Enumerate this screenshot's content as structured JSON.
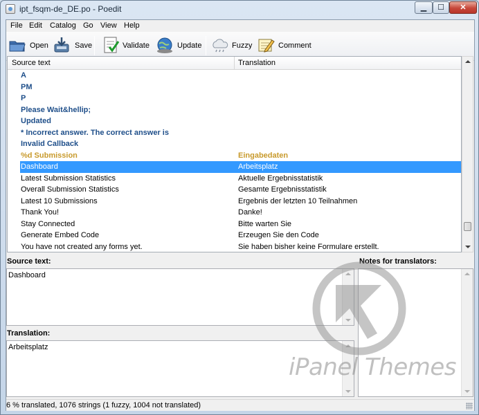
{
  "window": {
    "title": "ipt_fsqm-de_DE.po - Poedit",
    "min_glyph": "▁",
    "max_glyph": "☐",
    "close_glyph": "✕"
  },
  "menu": [
    "File",
    "Edit",
    "Catalog",
    "Go",
    "View",
    "Help"
  ],
  "toolbar": {
    "open": "Open",
    "save": "Save",
    "validate": "Validate",
    "update": "Update",
    "fuzzy": "Fuzzy",
    "comment": "Comment"
  },
  "list": {
    "col_source": "Source text",
    "col_translation": "Translation",
    "rows": [
      {
        "source": "A",
        "translation": "",
        "state": "untranslated"
      },
      {
        "source": "PM",
        "translation": "",
        "state": "untranslated"
      },
      {
        "source": "P",
        "translation": "",
        "state": "untranslated"
      },
      {
        "source": "Please Wait&hellip;",
        "translation": "",
        "state": "untranslated"
      },
      {
        "source": "Updated",
        "translation": "",
        "state": "untranslated"
      },
      {
        "source": "* Incorrect answer. The correct answer is",
        "translation": "",
        "state": "untranslated"
      },
      {
        "source": "Invalid Callback",
        "translation": "",
        "state": "untranslated"
      },
      {
        "source": "%d Submission",
        "translation": "Eingabedaten",
        "state": "fuzzy"
      },
      {
        "source": "Dashboard",
        "translation": "Arbeitsplatz",
        "state": "selected"
      },
      {
        "source": "Latest Submission Statistics",
        "translation": "Aktuelle Ergebnisstatistik",
        "state": "translated"
      },
      {
        "source": "Overall Submission Statistics",
        "translation": "Gesamte Ergebnisstatistik",
        "state": "translated"
      },
      {
        "source": "Latest 10 Submissions",
        "translation": "Ergebnis der letzten 10 Teilnahmen",
        "state": "translated"
      },
      {
        "source": "Thank You!",
        "translation": "Danke!",
        "state": "translated"
      },
      {
        "source": "Stay Connected",
        "translation": "Bitte warten Sie",
        "state": "translated"
      },
      {
        "source": "Generate Embed Code",
        "translation": "Erzeugen Sie den Code",
        "state": "translated"
      },
      {
        "source": "You have not created any forms yet.",
        "translation": "Sie haben bisher keine Formulare erstellt.",
        "state": "translated"
      }
    ]
  },
  "editor": {
    "source_label": "Source text:",
    "source_value": "Dashboard",
    "translation_label": "Translation:",
    "translation_value": "Arbeitsplatz",
    "notes_label": "Notes for translators:"
  },
  "status": "6 % translated, 1076 strings (1 fuzzy, 1004 not translated)",
  "watermark": "iPanel Themes",
  "colors": {
    "selection": "#3399ff",
    "untranslated": "#1f4f8a",
    "fuzzy": "#c89a2c"
  }
}
